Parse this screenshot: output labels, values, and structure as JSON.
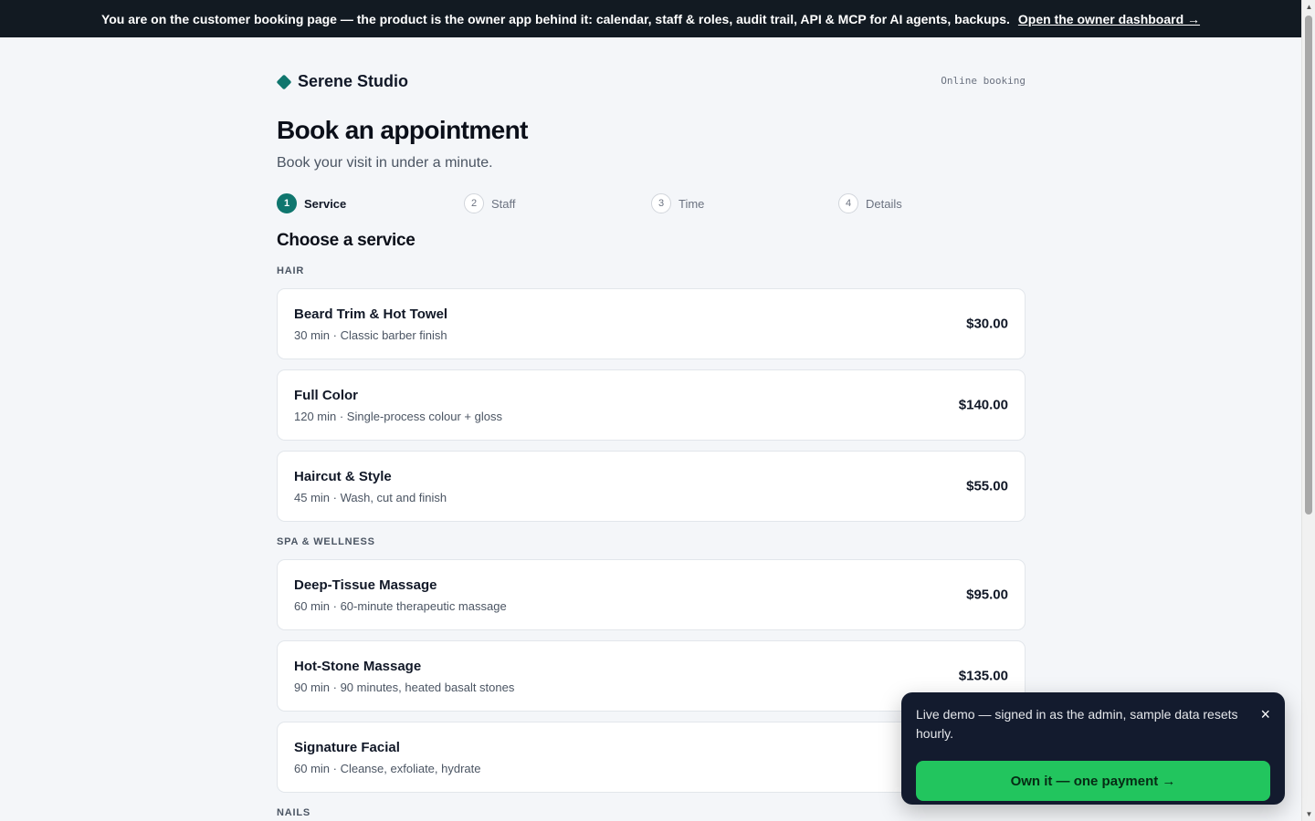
{
  "banner": {
    "text": "You are on the customer booking page — the product is the owner app behind it: calendar, staff & roles, audit trail, API & MCP for AI agents, backups.",
    "link_label": "Open the owner dashboard →"
  },
  "header": {
    "brand_name": "Serene Studio",
    "mode_label": "Online booking"
  },
  "page": {
    "title": "Book an appointment",
    "subtitle": "Book your visit in under a minute."
  },
  "steps": [
    {
      "number": "1",
      "label": "Service",
      "active": true
    },
    {
      "number": "2",
      "label": "Staff",
      "active": false
    },
    {
      "number": "3",
      "label": "Time",
      "active": false
    },
    {
      "number": "4",
      "label": "Details",
      "active": false
    }
  ],
  "section_title": "Choose a service",
  "categories": [
    {
      "name": "HAIR",
      "services": [
        {
          "name": "Beard Trim & Hot Towel",
          "details": "30 min · Classic barber finish",
          "price": "$30.00"
        },
        {
          "name": "Full Color",
          "details": "120 min · Single-process colour + gloss",
          "price": "$140.00"
        },
        {
          "name": "Haircut & Style",
          "details": "45 min · Wash, cut and finish",
          "price": "$55.00"
        }
      ]
    },
    {
      "name": "SPA & WELLNESS",
      "services": [
        {
          "name": "Deep-Tissue Massage",
          "details": "60 min · 60-minute therapeutic massage",
          "price": "$95.00"
        },
        {
          "name": "Hot-Stone Massage",
          "details": "90 min · 90 minutes, heated basalt stones",
          "price": "$135.00"
        },
        {
          "name": "Signature Facial",
          "details": "60 min · Cleanse, exfoliate, hydrate",
          "price": ""
        }
      ]
    },
    {
      "name": "NAILS",
      "services": []
    }
  ],
  "toast": {
    "message": "Live demo — signed in as the admin, sample data resets hourly.",
    "close_icon": "×",
    "cta_label": "Own it — one payment →"
  },
  "colors": {
    "accent": "#0f766e",
    "banner_bg": "#121a22",
    "toast_bg": "#131b2e",
    "cta_green": "#22c55e"
  }
}
